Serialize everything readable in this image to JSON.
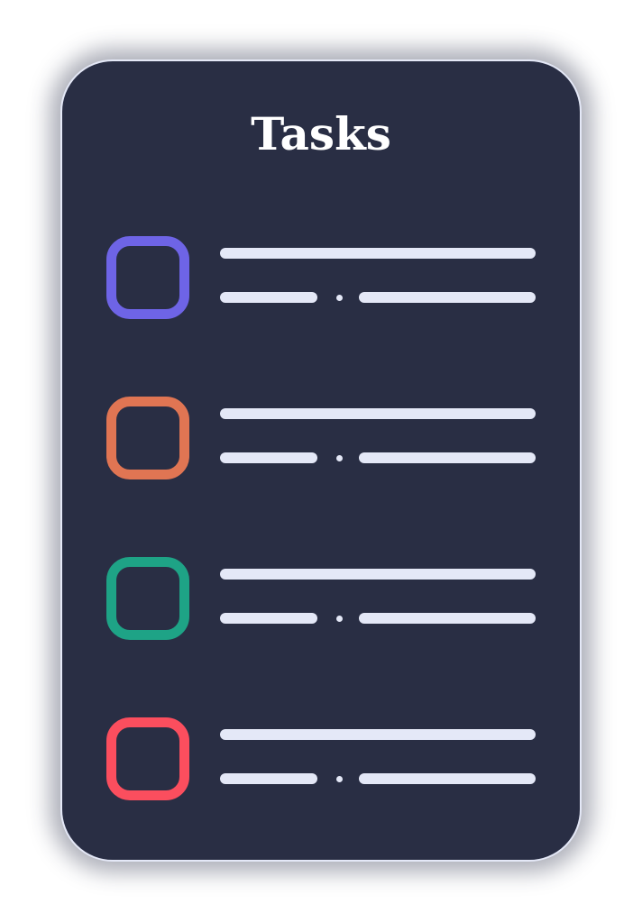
{
  "header": {
    "title": "Tasks"
  },
  "colors": {
    "card_background": "#292e44",
    "card_border": "#e4e8f7",
    "text_placeholder": "#e4e8f7",
    "title": "#ffffff"
  },
  "tasks": [
    {
      "checkbox_color": "#6e64e6",
      "checked": false
    },
    {
      "checkbox_color": "#e07553",
      "checked": false
    },
    {
      "checkbox_color": "#1ea386",
      "checked": false
    },
    {
      "checkbox_color": "#fb4e5e",
      "checked": false
    }
  ]
}
